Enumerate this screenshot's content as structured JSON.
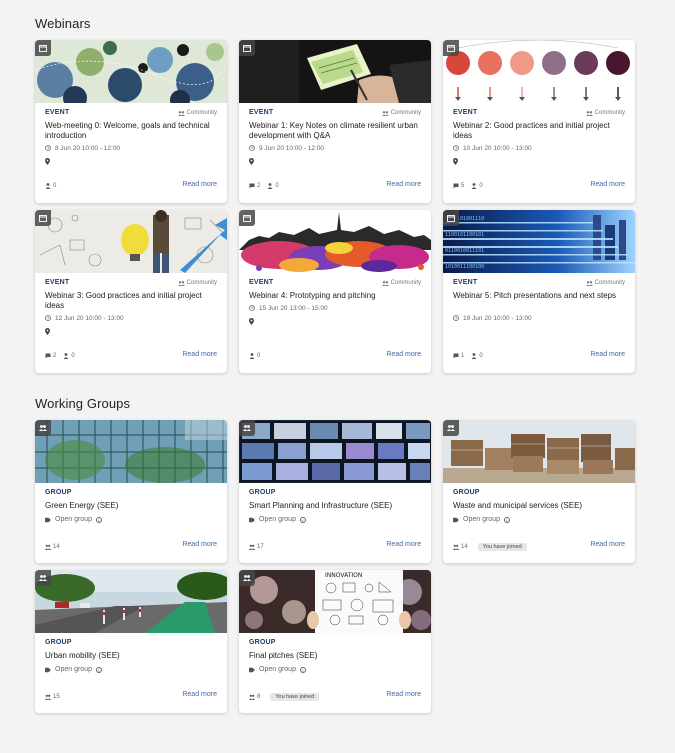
{
  "sections": {
    "webinars_title": "Webinars",
    "groups_title": "Working Groups"
  },
  "common": {
    "event_label": "EVENT",
    "group_label": "GROUP",
    "community_label": "Community",
    "read_more": "Read more",
    "open_group": "Open group",
    "joined_label": "You have joined"
  },
  "events": [
    {
      "title": "Web-meeting 0: Welcome, goals and technical introduction",
      "datetime": "8 Jun 20 10:00 - 12:00",
      "comments": "",
      "attendees": "0"
    },
    {
      "title": "Webinar 1: Key Notes on climate resilient urban development with Q&A",
      "datetime": "9 Jun 20 10:00 - 12:00",
      "comments": "2",
      "attendees": "0"
    },
    {
      "title": "Webinar 2: Good practices and initial project ideas",
      "datetime": "10 Jun 20 10:00 - 13:00",
      "comments": "5",
      "attendees": "0"
    },
    {
      "title": "Webinar 3: Good practices and initial project ideas",
      "datetime": "12 Jun 20 10:00 - 13:00",
      "comments": "2",
      "attendees": "0"
    },
    {
      "title": "Webinar 4: Prototyping and pitching",
      "datetime": "15 Jun 20 13:00 - 15:00",
      "comments": "",
      "attendees": "0"
    },
    {
      "title": "Webinar 5: Pitch presentations and next steps",
      "datetime": "19 Jun 20 10:00 - 13:00",
      "comments": "1",
      "attendees": "0"
    }
  ],
  "groups": [
    {
      "title": "Green Energy (SEE)",
      "members": "14",
      "joined": false
    },
    {
      "title": "Smart Planning and Infrastructure (SEE)",
      "members": "17",
      "joined": false
    },
    {
      "title": "Waste and municipal services (SEE)",
      "members": "14",
      "joined": true
    },
    {
      "title": "Urban mobility (SEE)",
      "members": "15",
      "joined": false
    },
    {
      "title": "Final pitches (SEE)",
      "members": "8",
      "joined": true
    }
  ],
  "image_text": {
    "innovation": "INNOVATION"
  }
}
